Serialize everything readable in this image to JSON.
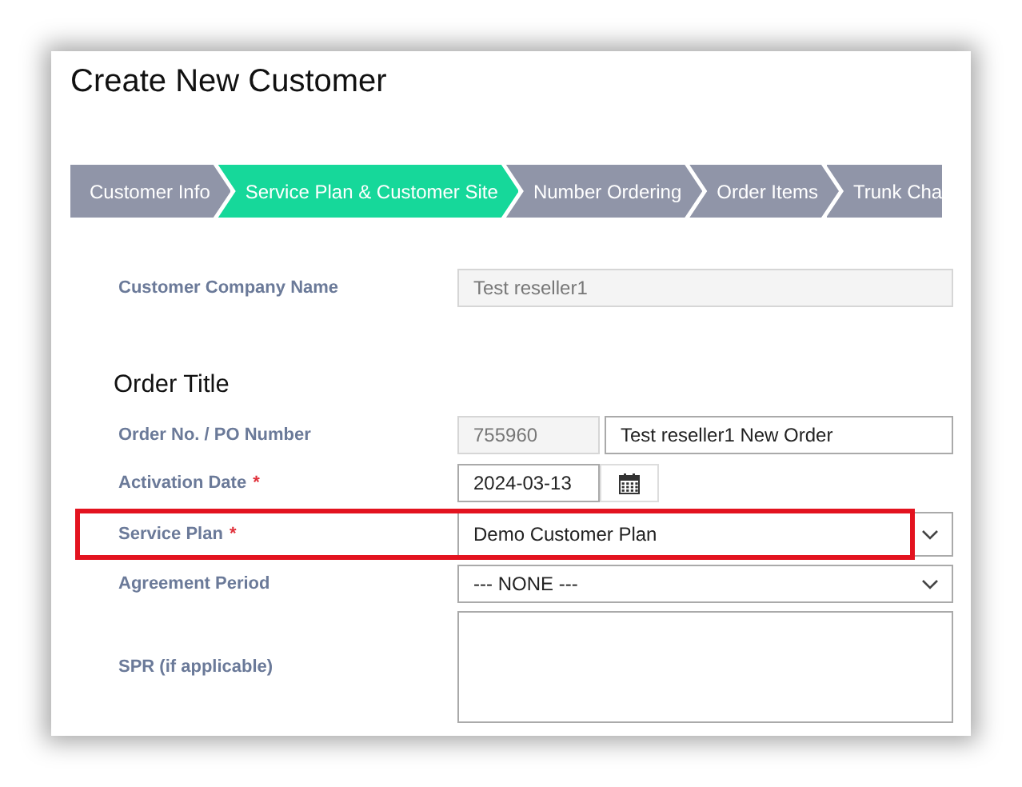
{
  "title": "Create New Customer",
  "steps": [
    {
      "label": "Customer Info",
      "selected": false
    },
    {
      "label": "Service Plan & Customer Site",
      "selected": true
    },
    {
      "label": "Number Ordering",
      "selected": false
    },
    {
      "label": "Order Items",
      "selected": false
    },
    {
      "label": "Trunk Cha",
      "selected": false
    }
  ],
  "sections": [
    {
      "fields": [
        {
          "kind": "text",
          "label": "Customer Company Name",
          "value": "Test reseller1",
          "readonly": true,
          "highlighted": false
        }
      ]
    },
    {
      "heading": "Order Title",
      "fields": [
        {
          "kind": "pair",
          "label": "Order No. / PO Number",
          "value": "755960",
          "second_value": "Test reseller1 New Order",
          "readonly": true,
          "highlighted": false
        },
        {
          "kind": "date",
          "label": "Activation Date",
          "required_mark": "*",
          "value": "2024-03-13",
          "readonly": false,
          "highlighted": false
        },
        {
          "kind": "select",
          "label": "Service Plan",
          "required_mark": "*",
          "value": "Demo Customer Plan",
          "highlighted": true
        },
        {
          "kind": "select",
          "label": "Agreement Period",
          "value": "--- NONE ---",
          "highlighted": false
        },
        {
          "kind": "textarea",
          "label": "SPR (if applicable)",
          "highlighted": false
        }
      ]
    }
  ]
}
